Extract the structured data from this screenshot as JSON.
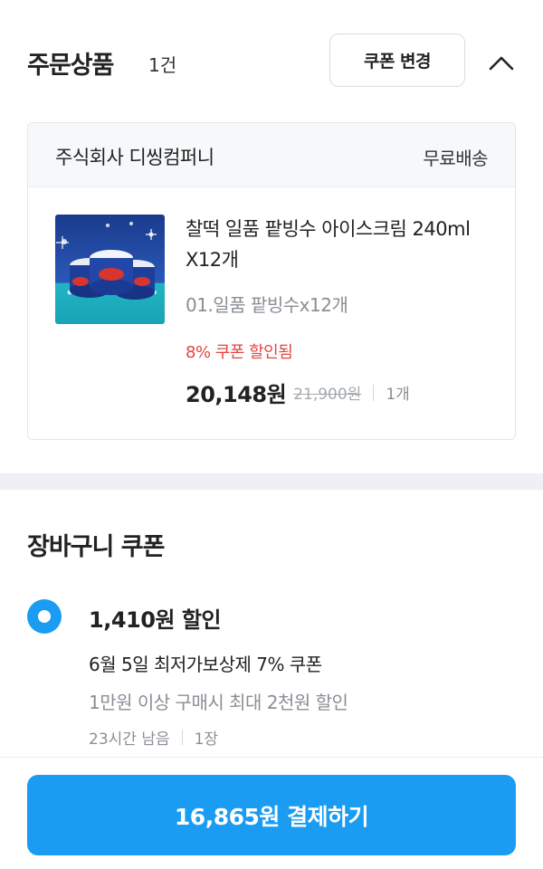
{
  "order": {
    "title": "주문상품",
    "count": "1건",
    "coupon_change_label": "쿠폰 변경"
  },
  "seller": {
    "name": "주식회사 디씽컴퍼니",
    "shipping": "무료배송"
  },
  "product": {
    "name": "찰떡 일품 팥빙수 아이스크림 240ml X12개",
    "option": "01.일품 팥빙수x12개",
    "discount_note": "8% 쿠폰 할인됨",
    "price": "20,148원",
    "original_price": "21,900원",
    "quantity": "1개",
    "thumbnail_icon": "ice-cream-cups-image"
  },
  "cart_coupon": {
    "title": "장바구니 쿠폰",
    "selected": true,
    "amount": "1,410원 할인",
    "name": "6월 5일 최저가보상제 7% 쿠폰",
    "condition": "1만원 이상 구매시 최대 2천원 할인",
    "time_left": "23시간 남음",
    "count": "1장"
  },
  "checkout": {
    "pay_label": "16,865원 결제하기"
  },
  "colors": {
    "accent": "#1a9cf2",
    "discount": "#e0473f",
    "muted": "#8a8f96"
  }
}
